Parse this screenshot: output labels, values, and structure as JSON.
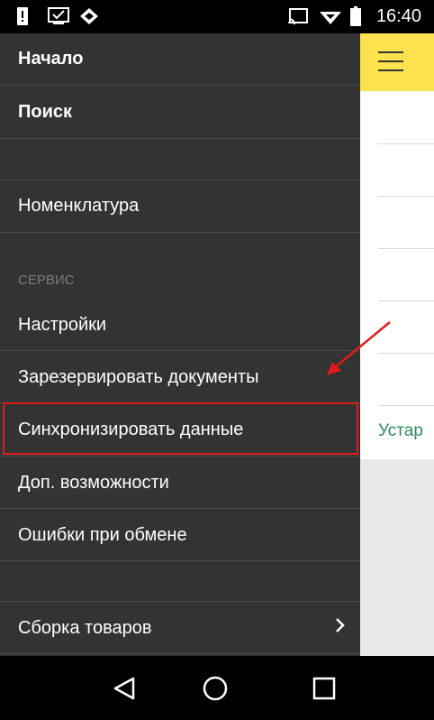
{
  "status_bar": {
    "time": "16:40",
    "icons": [
      "alert-icon",
      "checkbox-icon",
      "diamond-icon",
      "cast-icon",
      "wifi-icon",
      "battery-icon"
    ]
  },
  "background_app": {
    "partial_text": "Устар",
    "header_color": "#fde24f"
  },
  "drawer": {
    "items_top": [
      {
        "label": "Начало"
      },
      {
        "label": "Поиск"
      }
    ],
    "item_nomenclature": "Номенклатура",
    "section_service": "СЕРВИС",
    "items_service": [
      {
        "label": "Настройки"
      },
      {
        "label": "Зарезервировать документы"
      },
      {
        "label": "Синхронизировать данные"
      },
      {
        "label": "Доп. возможности"
      },
      {
        "label": "Ошибки при обмене"
      }
    ],
    "item_assembly": "Сборка товаров"
  },
  "nav_bar": {
    "buttons": [
      "back-icon",
      "home-icon",
      "recents-icon"
    ]
  },
  "colors": {
    "drawer_bg": "#333333",
    "highlight": "#e01b1b",
    "accent_yellow": "#fde24f"
  }
}
